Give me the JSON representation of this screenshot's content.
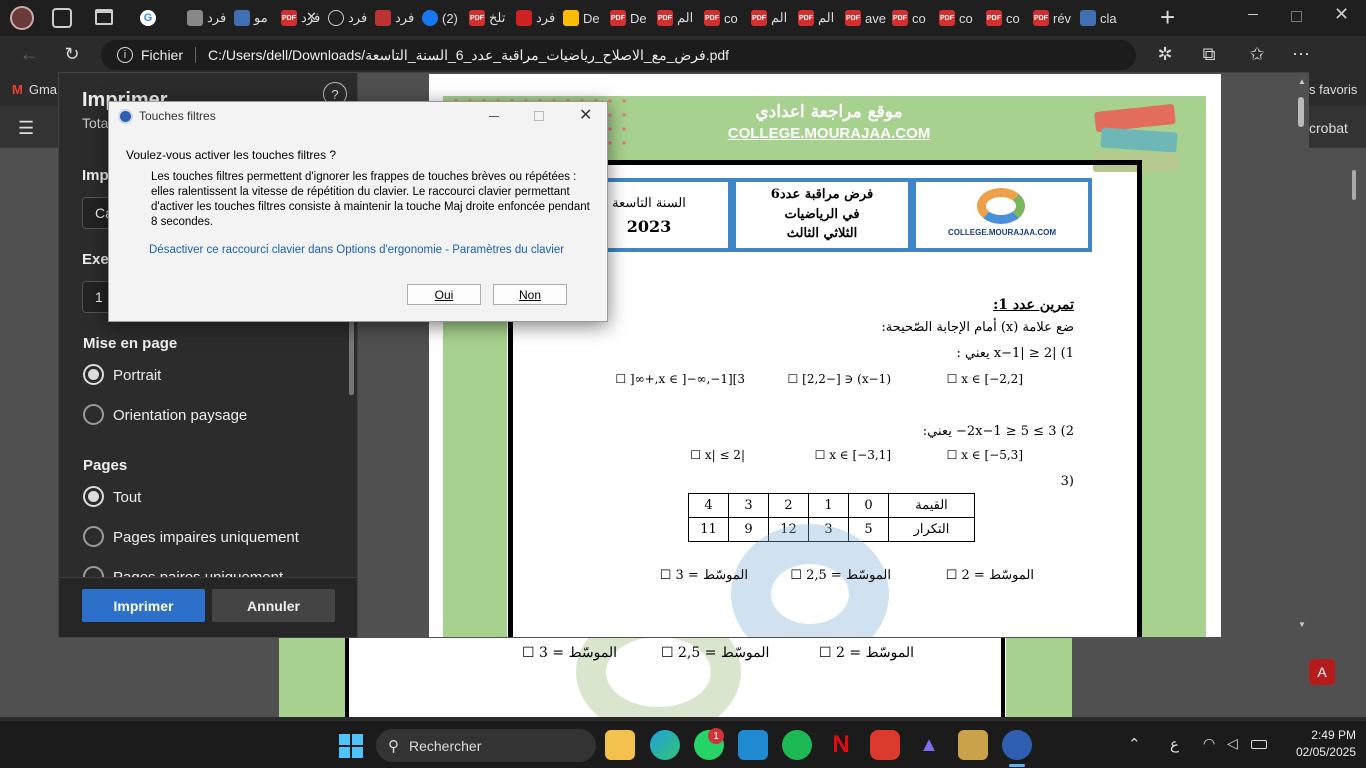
{
  "browser": {
    "tabs": [
      {
        "label": "",
        "icon": "google-icon"
      },
      {
        "label": "فرد",
        "icon": "avatar-icon"
      },
      {
        "label": "مو",
        "icon": "app-icon"
      },
      {
        "label": "فرد",
        "icon": "pdf-icon"
      },
      {
        "label": "فرد",
        "icon": "globe-icon"
      },
      {
        "label": "فرد",
        "icon": "image-icon"
      },
      {
        "label": "(2)",
        "icon": "facebook-icon"
      },
      {
        "label": "تلخ",
        "icon": "pdf-icon"
      },
      {
        "label": "فرد",
        "icon": "bookmark-icon"
      },
      {
        "label": "De",
        "icon": "drive-icon"
      },
      {
        "label": "De",
        "icon": "pdf-icon"
      },
      {
        "label": "الم",
        "icon": "pdf-icon"
      },
      {
        "label": "co",
        "icon": "pdf-icon"
      },
      {
        "label": "الم",
        "icon": "pdf-icon"
      },
      {
        "label": "الم",
        "icon": "pdf-icon"
      },
      {
        "label": "ave",
        "icon": "pdf-icon"
      },
      {
        "label": "co",
        "icon": "pdf-icon"
      },
      {
        "label": "co",
        "icon": "pdf-icon"
      },
      {
        "label": "co",
        "icon": "pdf-icon"
      },
      {
        "label": "rév",
        "icon": "pdf-icon"
      },
      {
        "label": "cla",
        "icon": "app-icon"
      }
    ],
    "address_prefix": "Fichier",
    "address_url": "C:/Users/dell/Downloads/فرض_مع_الاصلاح_رياضيات_مراقبة_عدد_6_السنة_التاسعة.pdf",
    "bookmark_gmail": "Gma",
    "bookmark_favoris": "s favoris",
    "acrobat_label": "crobat"
  },
  "print_dialog": {
    "title": "Imprimer",
    "subtitle": "Tota",
    "printer_label": "Imp",
    "printer_value": "Ca",
    "copies_label": "Exer",
    "copies_value": "1",
    "layout_title": "Mise en page",
    "portrait": "Portrait",
    "landscape": "Orientation paysage",
    "pages_title": "Pages",
    "all": "Tout",
    "odd": "Pages impaires uniquement",
    "even": "Pages paires uniquement",
    "print_button": "Imprimer",
    "cancel_button": "Annuler",
    "help": "?"
  },
  "modal": {
    "title": "Touches filtres",
    "question": "Voulez-vous activer les touches filtres ?",
    "body": "Les touches filtres permettent d'ignorer les frappes de touches brèves ou répétées : elles ralentissent la vitesse de répétition du clavier. Le raccourci clavier permettant d'activer les touches filtres consiste à maintenir la touche Maj droite enfoncée pendant 8 secondes.",
    "link": "Désactiver ce raccourci clavier dans Options d'ergonomie - Paramètres du clavier",
    "yes": "Oui",
    "no": "Non"
  },
  "document": {
    "site_ar": "موقع مراجعة اعدادي",
    "site_url": "COLLEGE.MOURAJAA.COM",
    "year_label": "السنة التاسعة",
    "year": "2023",
    "test_line1": "فرض مراقبة عدد6",
    "test_line2": "في الرياضيات",
    "test_line3": "الثلاثي الثالث",
    "logo_text": "COLLEGE.MOURAJAA.COM",
    "ex_title": "تمرين عدد 1:",
    "instruction": "ضع علامة (x) أمام الإجابة الصّحيحة:",
    "q1": "1)  |x−1| ≥ 2 يعني :",
    "q1_a": "x ∈ ]−∞,−1][3,+∞[ ☐",
    "q1_b": "(x−1) ∈ [−2,2] ☐",
    "q1_c": "x ∈ [−2,2] ☐",
    "q2": "2)  3 ≥ 2x−1 ≥ 5− يعني:",
    "q2_a": "|x| ≤ 2 ☐",
    "q2_b": "x ∈ [−3,1] ☐",
    "q2_c": "x ∈ [−5,3] ☐",
    "q3": "(3",
    "table_head_value": "القيمة",
    "table_head_freq": "التكرار",
    "table_values": [
      "4",
      "3",
      "2",
      "1",
      "0"
    ],
    "table_freqs": [
      "11",
      "9",
      "12",
      "3",
      "5"
    ],
    "median_a": "الموسّط = 3 ☐",
    "median_b": "الموسّط = 2,5 ☐",
    "median_c": "الموسّط = 2 ☐",
    "back_median_a": "الموسّط = 3 ☐",
    "back_median_b": "الموسّط = 2,5 ☐",
    "back_median_c": "الموسّط = 2 ☐"
  },
  "taskbar": {
    "search": "Rechercher",
    "lang": "ع",
    "time": "2:49 PM",
    "date": "02/05/2025",
    "whatsapp_badge": "1"
  }
}
